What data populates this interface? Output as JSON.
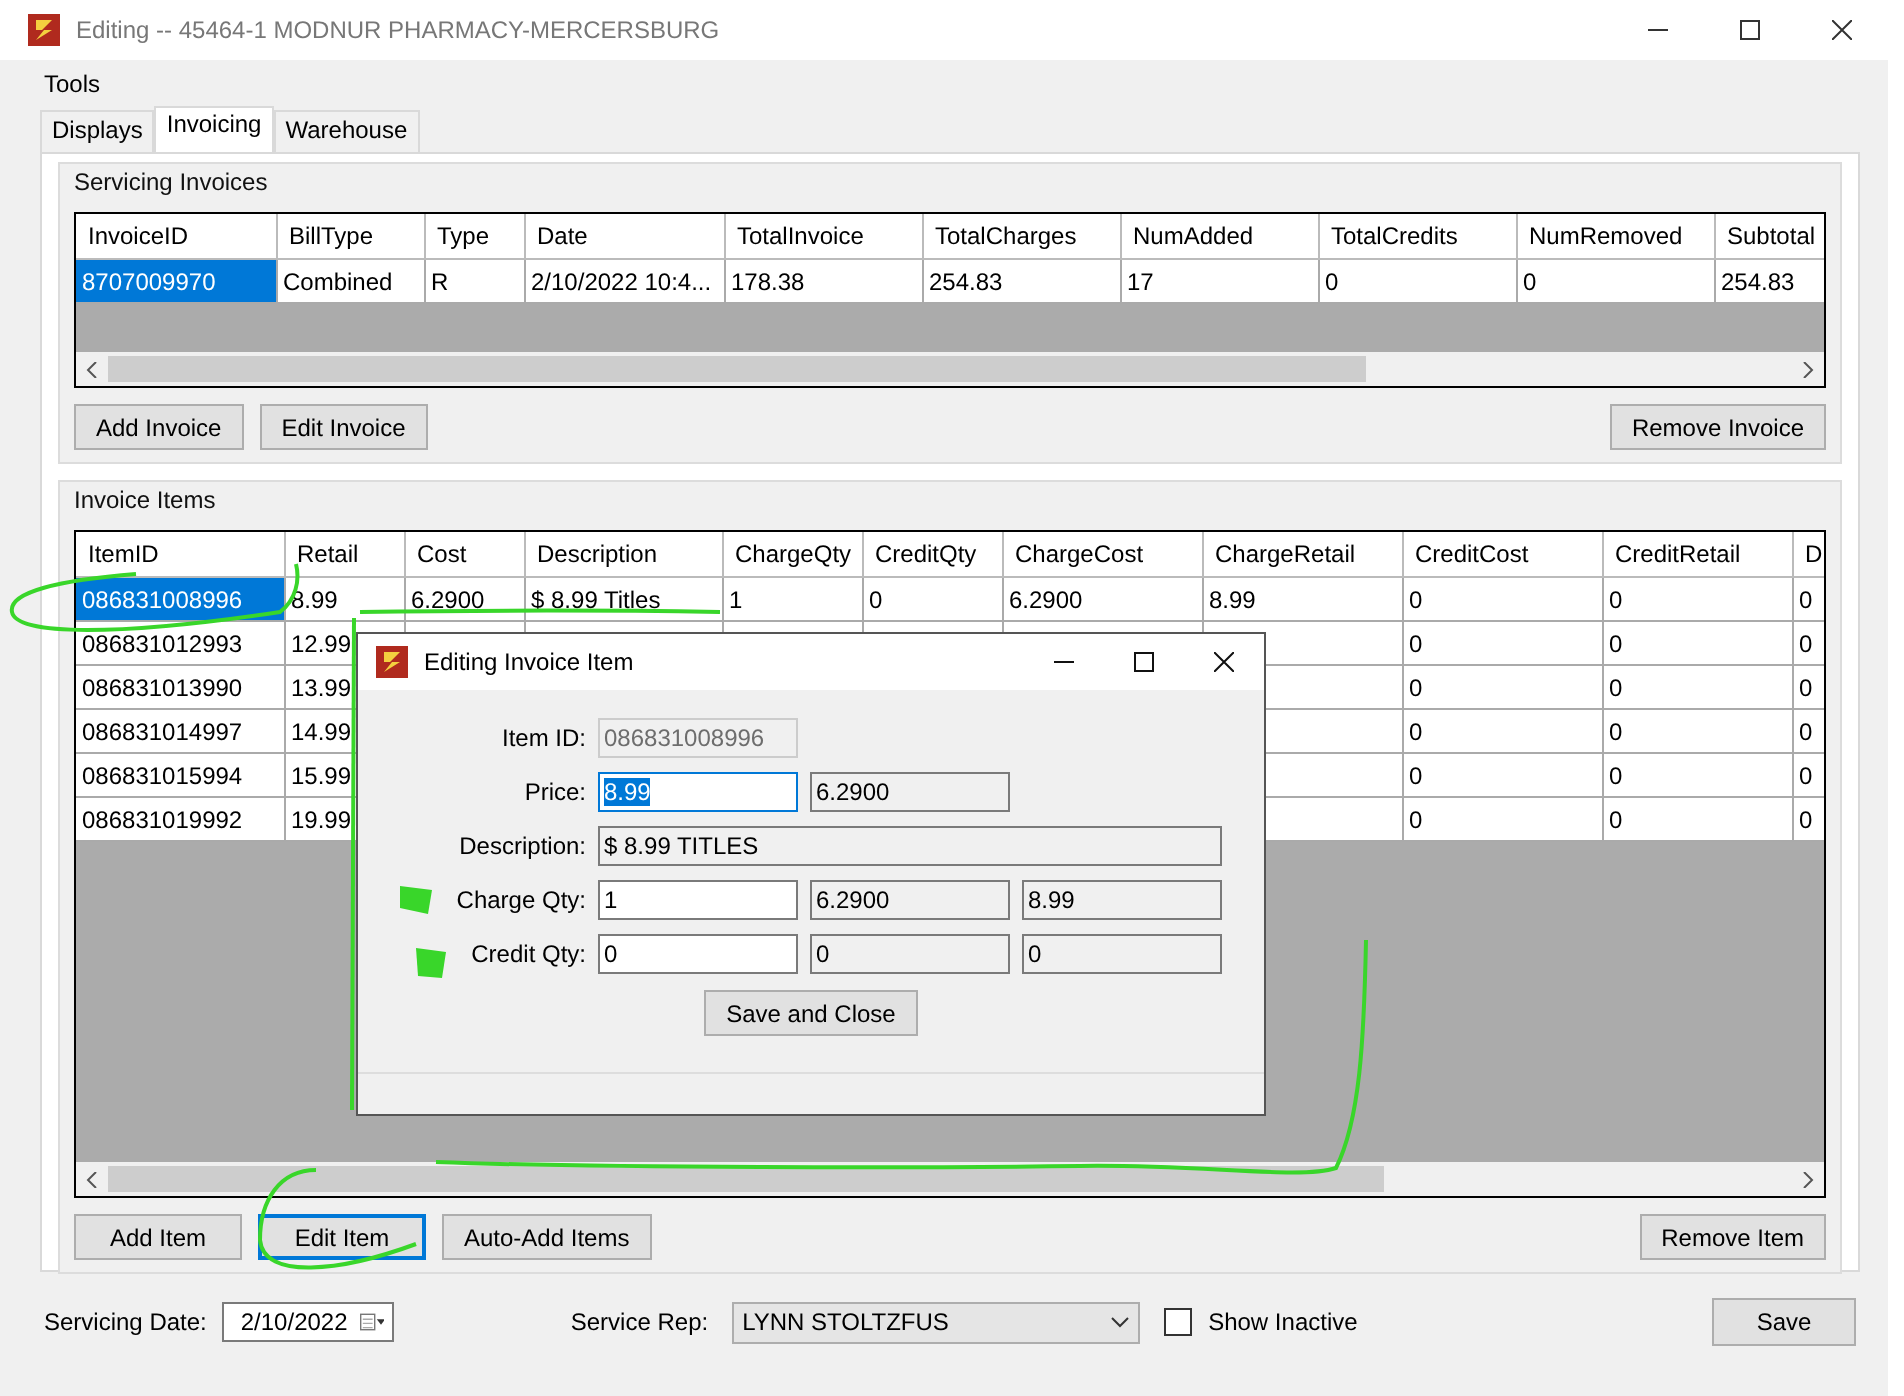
{
  "window": {
    "title": "Editing -- 45464-1 MODNUR PHARMACY-MERCERSBURG"
  },
  "menu": [
    "Tools"
  ],
  "tabs": [
    {
      "label": "Displays",
      "selected": false
    },
    {
      "label": "Invoicing",
      "selected": true
    },
    {
      "label": "Warehouse",
      "selected": false
    }
  ],
  "servicing_invoices": {
    "title": "Servicing Invoices",
    "columns": [
      "InvoiceID",
      "BillType",
      "Type",
      "Date",
      "TotalInvoice",
      "TotalCharges",
      "NumAdded",
      "TotalCredits",
      "NumRemoved",
      "Subtotal"
    ],
    "rows": [
      {
        "selected": true,
        "cells": [
          "8707009970",
          "Combined",
          "R",
          "2/10/2022 10:4...",
          "178.38",
          "254.83",
          "17",
          "0",
          "0",
          "254.83"
        ]
      }
    ],
    "buttons_left": [
      "Add Invoice",
      "Edit Invoice"
    ],
    "buttons_right": [
      "Remove Invoice"
    ]
  },
  "invoice_items": {
    "title": "Invoice Items",
    "columns": [
      "ItemID",
      "Retail",
      "Cost",
      "Description",
      "ChargeQty",
      "CreditQty",
      "ChargeCost",
      "ChargeRetail",
      "CreditCost",
      "CreditRetail",
      "D"
    ],
    "rows": [
      {
        "selected": true,
        "cells": [
          "086831008996",
          "8.99",
          "6.2900",
          "$  8.99 Titles",
          "1",
          "0",
          "6.2900",
          "8.99",
          "0",
          "0",
          "0"
        ]
      },
      {
        "selected": false,
        "cells": [
          "086831012993",
          "12.99",
          null,
          null,
          null,
          null,
          null,
          null,
          "0",
          "0",
          "0"
        ]
      },
      {
        "selected": false,
        "cells": [
          "086831013990",
          "13.99",
          null,
          null,
          null,
          null,
          null,
          null,
          "0",
          "0",
          "0"
        ]
      },
      {
        "selected": false,
        "cells": [
          "086831014997",
          "14.99",
          null,
          null,
          null,
          null,
          null,
          null,
          "0",
          "0",
          "0"
        ]
      },
      {
        "selected": false,
        "cells": [
          "086831015994",
          "15.99",
          null,
          null,
          null,
          null,
          null,
          null,
          "0",
          "0",
          "0"
        ]
      },
      {
        "selected": false,
        "cells": [
          "086831019992",
          "19.99",
          null,
          null,
          null,
          null,
          null,
          null,
          "0",
          "0",
          "0"
        ]
      }
    ],
    "buttons_left": [
      {
        "label": "Add Item",
        "focused": false
      },
      {
        "label": "Edit Item",
        "focused": true
      },
      {
        "label": "Auto-Add Items",
        "focused": false
      }
    ],
    "buttons_right": [
      "Remove Item"
    ]
  },
  "footer": {
    "date_label": "Servicing Date:",
    "date": "2/10/2022",
    "rep_label": "Service Rep:",
    "rep": "LYNN STOLTZFUS",
    "show_inactive": {
      "label": "Show Inactive",
      "checked": false
    },
    "save": "Save"
  },
  "dialog": {
    "title": "Editing Invoice Item",
    "item_id": {
      "label": "Item ID:",
      "value": "086831008996"
    },
    "price": {
      "label": "Price:",
      "value": "8.99",
      "cost": "6.2900"
    },
    "description": {
      "label": "Description:",
      "value": "$  8.99 TITLES"
    },
    "charge_qty": {
      "label": "Charge Qty:",
      "value": "1",
      "cost": "6.2900",
      "retail": "8.99"
    },
    "credit_qty": {
      "label": "Credit Qty:",
      "value": "0",
      "cost": "0",
      "retail": "0"
    },
    "button": "Save and Close"
  }
}
